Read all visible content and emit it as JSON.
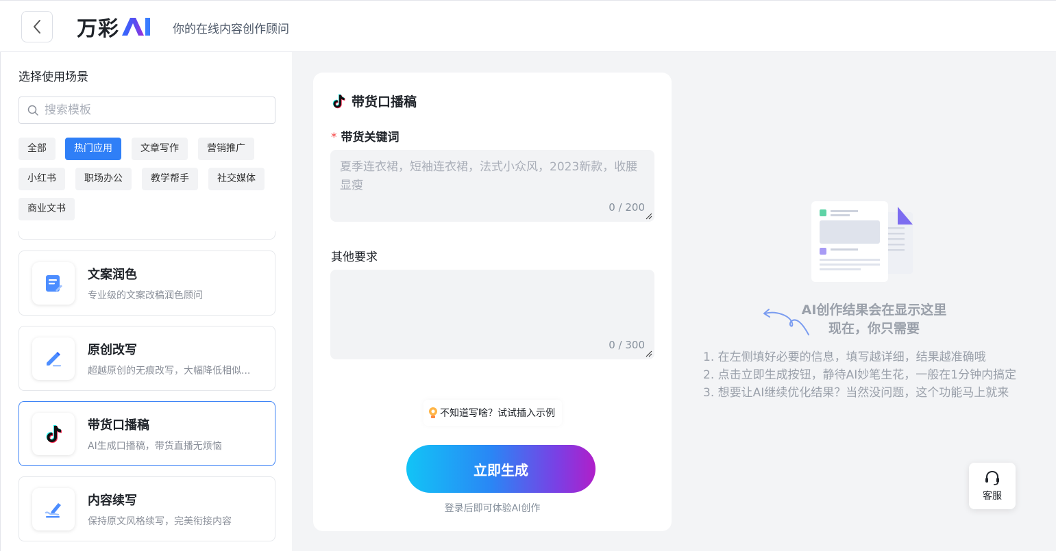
{
  "header": {
    "logo_text": "万彩",
    "logo_ai": "AI",
    "tagline": "你的在线内容创作顾问"
  },
  "sidebar": {
    "title": "选择使用场景",
    "search_placeholder": "搜索模板",
    "tags": [
      {
        "label": "全部",
        "active": false
      },
      {
        "label": "热门应用",
        "active": true
      },
      {
        "label": "文章写作",
        "active": false
      },
      {
        "label": "营销推广",
        "active": false
      },
      {
        "label": "小红书",
        "active": false
      },
      {
        "label": "职场办公",
        "active": false
      },
      {
        "label": "教学帮手",
        "active": false
      },
      {
        "label": "社交媒体",
        "active": false
      },
      {
        "label": "商业文书",
        "active": false
      }
    ],
    "cards": [
      {
        "title": "文案润色",
        "desc": "专业级的文案改稿润色顾问",
        "icon": "document-edit-icon",
        "active": false
      },
      {
        "title": "原创改写",
        "desc": "超越原创的无痕改写，大幅降低相似...",
        "icon": "pencil-icon",
        "active": false
      },
      {
        "title": "带货口播稿",
        "desc": "AI生成口播稿，带货直播无烦恼",
        "icon": "tiktok-icon",
        "active": true
      },
      {
        "title": "内容续写",
        "desc": "保持原文风格续写，完美衔接内容",
        "icon": "write-continue-icon",
        "active": false
      }
    ]
  },
  "form": {
    "title": "带货口播稿",
    "field1": {
      "required_mark": "*",
      "label": "带货关键词",
      "placeholder": "夏季连衣裙，短袖连衣裙，法式小众风，2023新款，收腰显瘦",
      "count": "0 / 200"
    },
    "field2": {
      "label": "其他要求",
      "placeholder": "",
      "count": "0 / 300"
    },
    "hint": "不知道写啥？试试插入示例",
    "generate_label": "立即生成",
    "login_tip": "登录后即可体验AI创作"
  },
  "result": {
    "title_line1": "AI创作结果会在显示这里",
    "title_line2": "现在，你只需要",
    "steps": [
      "1. 在左侧填好必要的信息，填写越详细，结果越准确哦",
      "2. 点击立即生成按钮，静待AI妙笔生花，一般在1分钟内搞定",
      "3. 想要让AI继续优化结果？当然没问题，这个功能马上就来"
    ]
  },
  "service": {
    "label": "客服",
    "icon": "headset-icon"
  },
  "colors": {
    "accent": "#2f7ff7",
    "active_border": "#3b82f6",
    "required": "#f53f3f"
  }
}
